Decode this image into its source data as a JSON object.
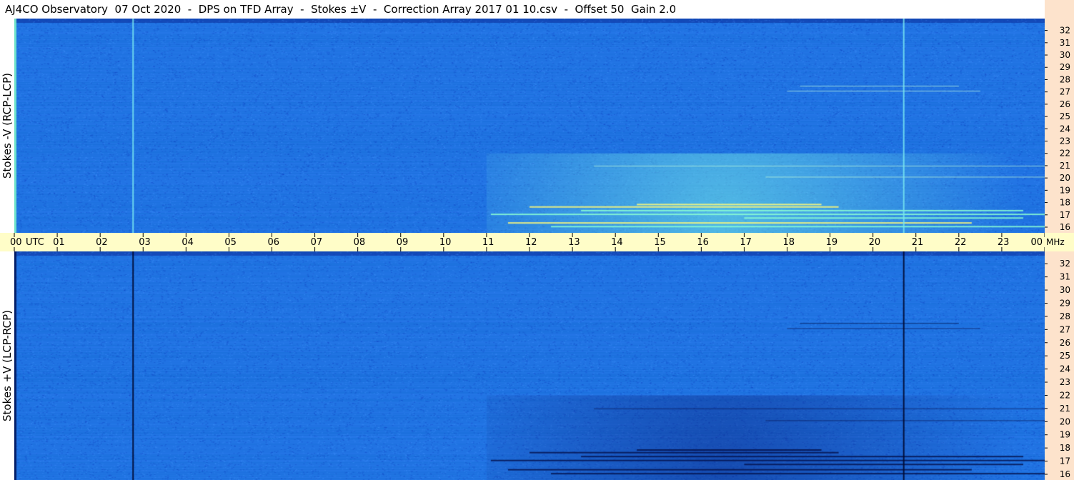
{
  "title": "AJ4CO Observatory  07 Oct 2020  -  DPS on TFD Array  -  Stokes ±V  -  Correction Array 2017 01 10.csv  -  Offset 50  Gain 2.0",
  "panels": [
    {
      "id": "top",
      "ylabel": "Stokes -V (RCP-LCP)"
    },
    {
      "id": "bottom",
      "ylabel": "Stokes +V (LCP-RCP)"
    }
  ],
  "colors": {
    "background": "#1f63e0",
    "freq_axis_bg": "#fde3cc",
    "time_axis_bg": "#fffdc8"
  },
  "chart_data": {
    "type": "heatmap",
    "x_unit": "UTC",
    "y_unit": "MHz",
    "x_ticks": [
      "00",
      "01",
      "02",
      "03",
      "04",
      "05",
      "06",
      "07",
      "08",
      "09",
      "10",
      "11",
      "12",
      "13",
      "14",
      "15",
      "16",
      "17",
      "18",
      "19",
      "20",
      "21",
      "22",
      "23",
      "00"
    ],
    "x_range": [
      0,
      24
    ],
    "y_ticks": [
      "32",
      "31",
      "30",
      "29",
      "28",
      "27",
      "26",
      "25",
      "24",
      "23",
      "22",
      "21",
      "20",
      "19",
      "18",
      "17",
      "16"
    ],
    "y_range": [
      16,
      32.5
    ],
    "time_axis_unit_label": "UTC",
    "freq_axis_unit_label": "MHz",
    "vertical_line_times_utc": [
      2.75,
      20.7
    ]
  }
}
